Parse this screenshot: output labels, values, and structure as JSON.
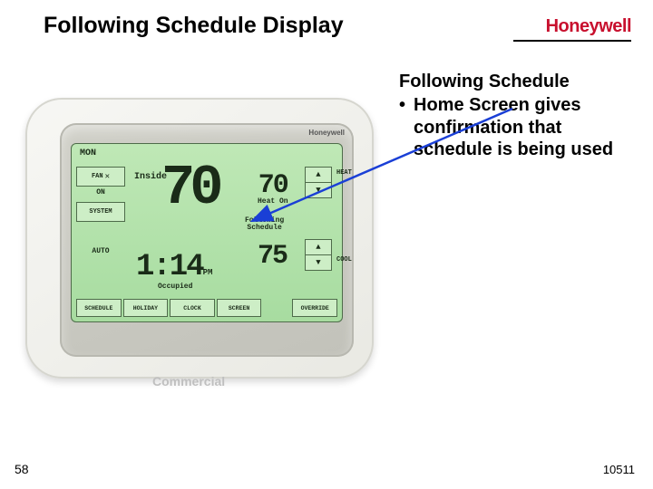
{
  "title": "Following Schedule Display",
  "brand": "Honeywell",
  "bullets": {
    "heading": "Following Schedule",
    "item1": "Home Screen gives confirmation that schedule is being used"
  },
  "device": {
    "bezel_brand": "Honeywell",
    "day": "MON",
    "fan_btn": "FAN",
    "fan_x": "✕",
    "fan_state": "ON",
    "system_btn": "SYSTEM",
    "auto_state": "AUTO",
    "inside_label": "Inside",
    "inside_temp": "70",
    "heat_sp": "70",
    "heat_label": "Heat On",
    "following_l1": "Following",
    "following_l2": "Schedule",
    "cool_sp": "75",
    "time": "1:14",
    "ampm": "PM",
    "occupied": "Occupied",
    "spin_up": "▲",
    "spin_dn": "▼",
    "spin_heat_label": "HEAT",
    "spin_cool_label": "COOL",
    "row": {
      "schedule": "SCHEDULE",
      "holiday": "HOLIDAY",
      "clock": "CLOCK",
      "screen": "SCREEN",
      "override": "OVERRIDE"
    }
  },
  "commercial_label": "Commercial",
  "page_number": "58",
  "doc_number": "10511"
}
